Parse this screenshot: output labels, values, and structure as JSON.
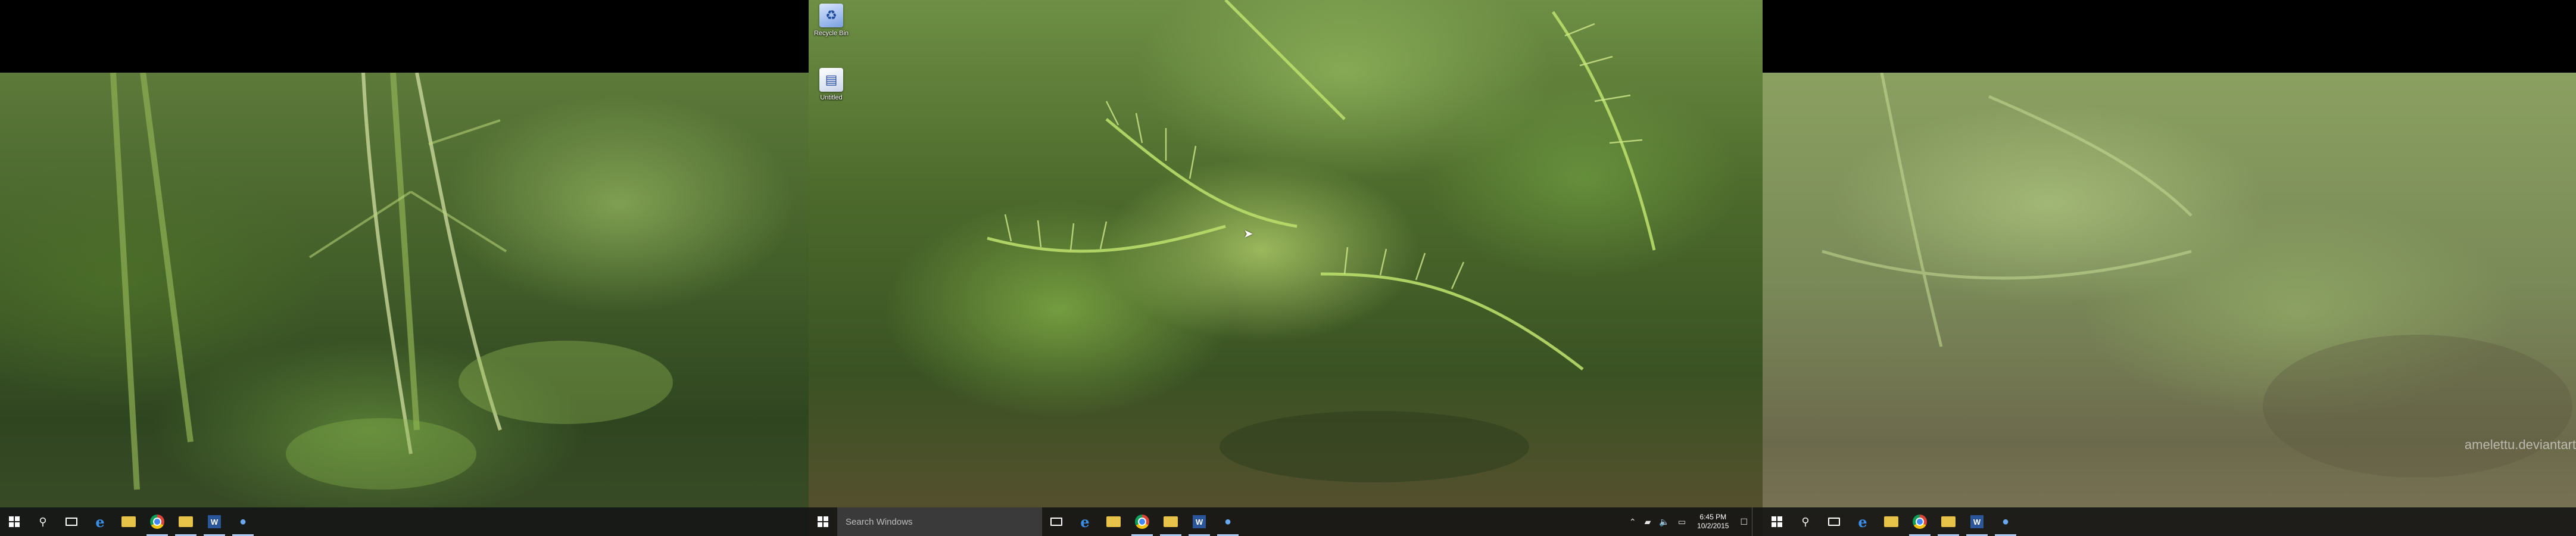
{
  "desktop_icons": [
    {
      "label": "Recycle Bin",
      "icon": "recycle-bin-icon"
    },
    {
      "label": "Untitled",
      "icon": "document-icon"
    }
  ],
  "taskbar": {
    "search_placeholder": "Search Windows",
    "clock_time": "6:45 PM",
    "clock_date": "10/2/2015",
    "tray_icons": [
      "chevron-up-icon",
      "network-icon",
      "volume-icon",
      "battery-icon",
      "action-center-icon"
    ]
  },
  "watermark": "amelettu.deviantart",
  "colors": {
    "taskbar": "#161616",
    "search_box": "#3a3a3a",
    "active_indicator": "#a8c8ee"
  }
}
